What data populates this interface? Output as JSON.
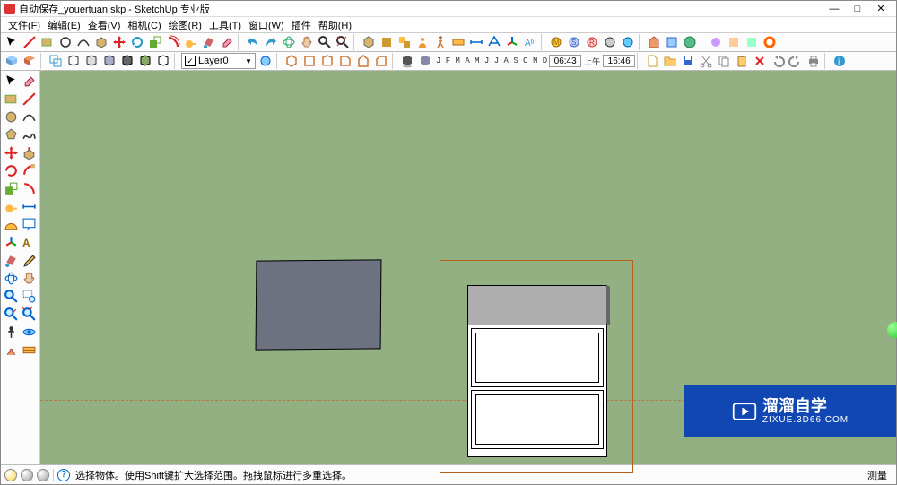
{
  "titlebar": {
    "title": "自动保存_youertuan.skp - SketchUp 专业版"
  },
  "menu": {
    "file": "文件(F)",
    "edit": "编辑(E)",
    "view": "查看(V)",
    "camera": "相机(C)",
    "draw": "绘图(R)",
    "tools": "工具(T)",
    "window": "窗口(W)",
    "plugins": "插件",
    "help": "帮助(H)"
  },
  "layer": {
    "name": "Layer0"
  },
  "time": {
    "dateseq": "J  F  M  A  M  J  J  A  S  O  N  D",
    "clock": "06:43",
    "ampm": "上午",
    "clock2": "16:46"
  },
  "status": {
    "hint": "选择物体。使用Shift键扩大选择范围。拖拽鼠标进行多重选择。",
    "measure_label": "测量"
  },
  "watermark": {
    "line1": "溜溜自学",
    "line2": "ZIXUE.3D66.COM"
  }
}
